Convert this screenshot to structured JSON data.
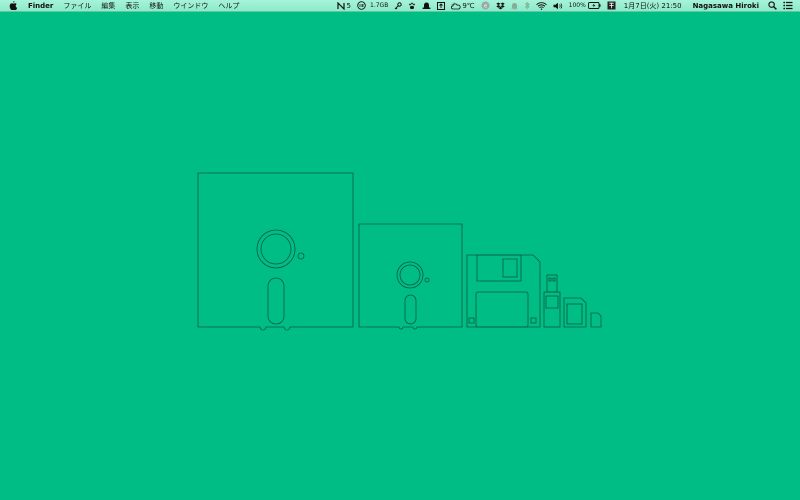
{
  "menubar": {
    "app_name": "Finder",
    "menus": [
      "ファイル",
      "編集",
      "表示",
      "移動",
      "ウインドウ",
      "ヘルプ"
    ],
    "status": {
      "notification_count": "5",
      "memory": "1.7GB",
      "temperature": "9℃",
      "battery": "100%",
      "datetime": "1月7日(火)  21:50",
      "user": "Nagasawa Hiroki"
    }
  },
  "desktop": {
    "background_color": "#00bd86",
    "line_color": "#0a5a3e"
  }
}
